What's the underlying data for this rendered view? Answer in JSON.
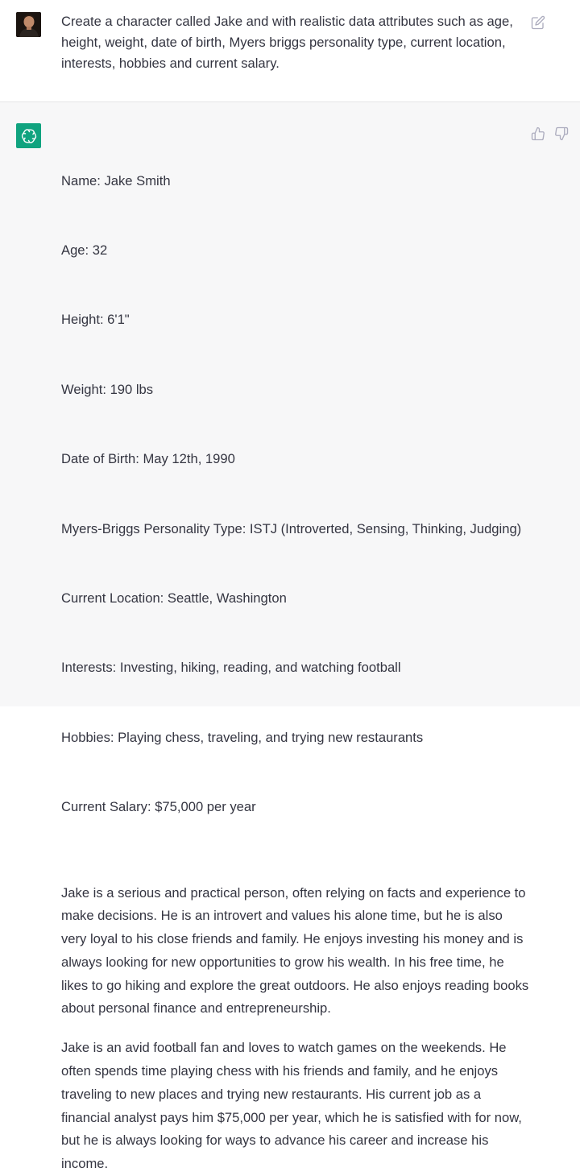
{
  "user_message": {
    "text": "Create a character called Jake and with realistic data attributes such as age, height, weight, date of birth, Myers briggs personality type, current location, interests, hobbies and current salary."
  },
  "assistant_message": {
    "attributes": [
      "Name: Jake Smith",
      "Age: 32",
      "Height: 6'1\"",
      "Weight: 190 lbs",
      "Date of Birth: May 12th, 1990",
      "Myers-Briggs Personality Type: ISTJ (Introverted, Sensing, Thinking, Judging)",
      "Current Location: Seattle, Washington",
      "Interests: Investing, hiking, reading, and watching football",
      "Hobbies: Playing chess, traveling, and trying new restaurants",
      "Current Salary: $75,000 per year"
    ],
    "paragraph_1": "Jake is a serious and practical person, often relying on facts and experience to make decisions. He is an introvert and values his alone time, but he is also very loyal to his close friends and family. He enjoys investing his money and is always looking for new opportunities to grow his wealth. In his free time, he likes to go hiking and explore the great outdoors. He also enjoys reading books about personal finance and entrepreneurship.",
    "paragraph_2": "Jake is an avid football fan and loves to watch games on the weekends. He often spends time playing chess with his friends and family, and he enjoys traveling to new places and trying new restaurants. His current job as a financial analyst pays him $75,000 per year, which he is satisfied with for now, but he is always looking for ways to advance his career and increase his income."
  },
  "icons": {
    "user_avatar": "user-avatar-photo",
    "bot_avatar": "openai-logo-icon",
    "edit": "edit-icon",
    "thumbs_up": "thumbs-up-icon",
    "thumbs_down": "thumbs-down-icon"
  },
  "colors": {
    "bot_avatar_bg": "#10a37f",
    "assistant_bg": "#f7f7f8",
    "text": "#343541",
    "icon": "#acacbe"
  }
}
